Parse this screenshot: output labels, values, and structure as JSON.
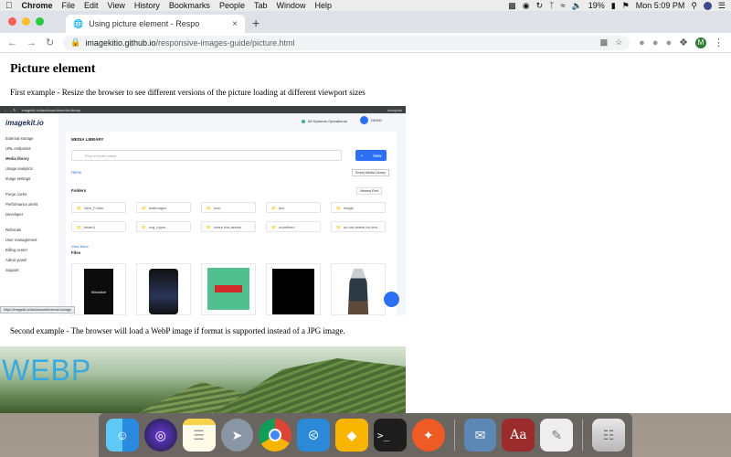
{
  "menubar": {
    "apple": "",
    "items": [
      "Chrome",
      "File",
      "Edit",
      "View",
      "History",
      "Bookmarks",
      "People",
      "Tab",
      "Window",
      "Help"
    ],
    "battery": "19%",
    "clock": "Mon 5:09 PM"
  },
  "browser": {
    "tab_title": "Using picture element - Respo",
    "url_host": "imagekitio.github.io",
    "url_path": "/responsive-images-guide/picture.html",
    "profile_initial": "M"
  },
  "page": {
    "heading": "Picture element",
    "para1": "First example - Resize the browser to see different versions of the picture loading at different viewport sizes",
    "para2": "Second example - The browser will load a WebP image if format is supported instead of a JPG image."
  },
  "embedded": {
    "url": "imagekit.io/dashboard#media-library",
    "incognito": "Incognito",
    "logo": "imagekit.io",
    "sidebar": [
      "External storage",
      "URL endpoints",
      "Media library",
      "Usage analytics",
      "Image settings",
      "",
      "Purge cache",
      "Performance alerts",
      "Developer",
      "",
      "Referrals",
      "User management",
      "Billing center",
      "Admin panel",
      "Support"
    ],
    "status": "All Systems Operational",
    "account": "DEMO",
    "section": "MEDIA LIBRARY",
    "search_placeholder": "Find in folder name",
    "new_button": "New",
    "breadcrumb": "Home",
    "empty_button": "Empty Media Library",
    "folders_heading": "Folders",
    "sort": "Newest First",
    "folders": [
      "New_Folder",
      "testimages",
      "icon",
      "dev",
      "image",
      "folder1",
      "svg_logos",
      "share this assets",
      "undefined",
      "do not delete-for-test"
    ],
    "view_more": "View More",
    "files_heading": "Files",
    "file_text": "Killswitch",
    "statusbar_link": "https://imagekit.io/dashboard#external-storage"
  },
  "webp_text": "WEBP",
  "dock": {
    "apps": [
      "finder-icon",
      "siri-icon",
      "notes-icon",
      "launchpad-icon",
      "chrome-icon",
      "vscode-icon",
      "sketch-icon",
      "terminal-icon",
      "postman-icon",
      "mail-icon",
      "dictionary-icon",
      "textedit-icon",
      "trash-icon"
    ]
  }
}
